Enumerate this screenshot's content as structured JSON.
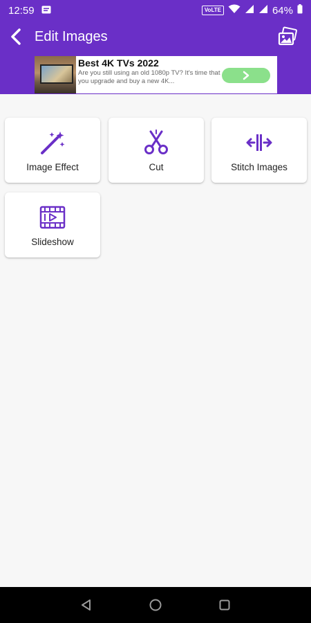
{
  "status_bar": {
    "time": "12:59",
    "network_badge": "VoLTE",
    "battery": "64%",
    "icons": [
      "message-icon",
      "wifi-icon",
      "signal-icon",
      "signal-icon",
      "battery-icon"
    ]
  },
  "app_bar": {
    "title": "Edit Images",
    "background_color": "#6a2fc7",
    "icons": [
      "back-arrow-icon",
      "gallery-icon"
    ]
  },
  "ad": {
    "title": "Best 4K TVs 2022",
    "description": "Are you still using an old 1080p TV? It's time that you upgrade and buy a new 4K...",
    "cta_icon": "chevron-right-icon",
    "cta_color": "#8be08b"
  },
  "tools": [
    {
      "label": "Image Effect",
      "icon": "magic-wand-icon"
    },
    {
      "label": "Cut",
      "icon": "scissors-icon"
    },
    {
      "label": "Stitch Images",
      "icon": "stitch-arrows-icon"
    },
    {
      "label": "Slideshow",
      "icon": "film-play-icon"
    }
  ],
  "accent_color": "#6a2fc7",
  "nav_bar": {
    "icons": [
      "back-triangle-icon",
      "home-circle-icon",
      "recents-square-icon"
    ]
  }
}
